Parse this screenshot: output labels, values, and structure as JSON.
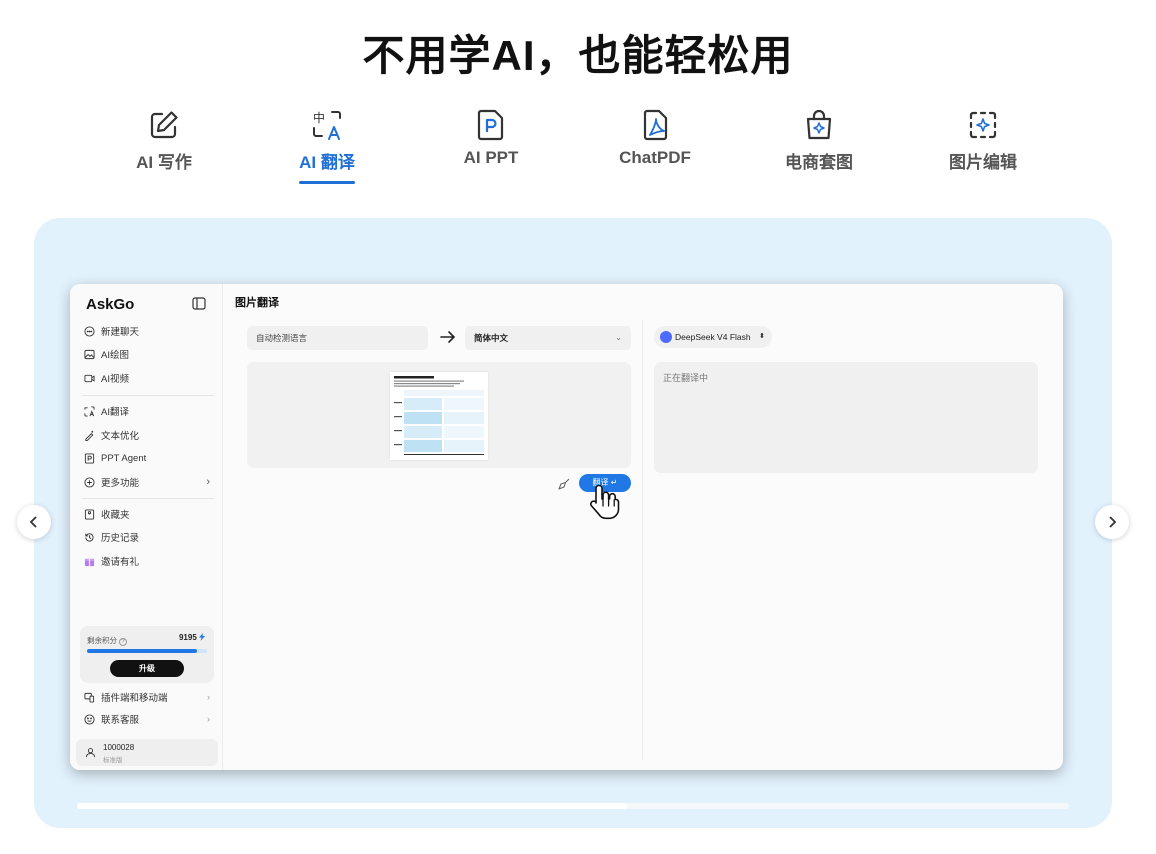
{
  "headline": "不用学AI，也能轻松用",
  "tabs": [
    {
      "label": "AI 写作",
      "icon": "pencil-square-icon",
      "active": false
    },
    {
      "label": "AI 翻译",
      "icon": "translate-icon",
      "active": true
    },
    {
      "label": "AI PPT",
      "icon": "ppt-file-icon",
      "active": false
    },
    {
      "label": "ChatPDF",
      "icon": "pdf-file-icon",
      "active": false
    },
    {
      "label": "电商套图",
      "icon": "shopping-bag-icon",
      "active": false
    },
    {
      "label": "图片编辑",
      "icon": "image-edit-icon",
      "active": false
    }
  ],
  "app": {
    "brand": "AskGo",
    "sidebar": {
      "group1": [
        {
          "label": "新建聊天",
          "icon": "chat-icon"
        },
        {
          "label": "AI绘图",
          "icon": "image-icon"
        },
        {
          "label": "AI视频",
          "icon": "video-icon"
        }
      ],
      "group2": [
        {
          "label": "AI翻译",
          "icon": "translate-icon"
        },
        {
          "label": "文本优化",
          "icon": "magic-pen-icon"
        },
        {
          "label": "PPT Agent",
          "icon": "ppt-icon"
        },
        {
          "label": "更多功能",
          "icon": "plus-circle-icon"
        }
      ],
      "group3": [
        {
          "label": "收藏夹",
          "icon": "bookmark-icon"
        },
        {
          "label": "历史记录",
          "icon": "history-icon"
        },
        {
          "label": "邀请有礼",
          "icon": "gift-icon"
        }
      ],
      "credits_label": "剩余积分",
      "credits_value": "9195",
      "credits_progress": 0.92,
      "upgrade_label": "升级",
      "bottom": [
        {
          "label": "插件端和移动端",
          "icon": "devices-icon"
        },
        {
          "label": "联系客服",
          "icon": "support-icon"
        }
      ],
      "user_id": "1000028",
      "user_tier": "标准版"
    },
    "page_title": "图片翻译",
    "source_language": "自动检测语言",
    "target_language": "简体中文",
    "translate_button": "翻译",
    "model": "DeepSeek V4 Flash",
    "output_status": "正在翻译中"
  },
  "colors": {
    "accent": "#1f6fd6",
    "stage_bg": "#e2f2fd",
    "button_blue": "#1f78e6"
  }
}
